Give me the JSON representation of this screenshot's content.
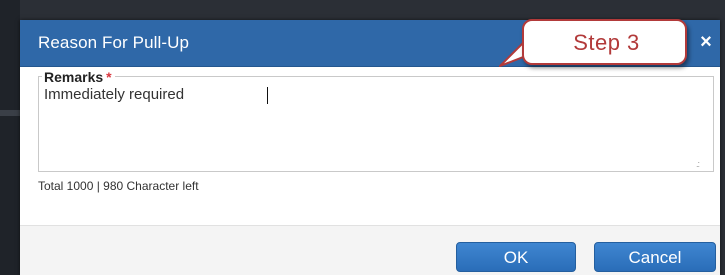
{
  "dialog": {
    "title": "Reason For Pull-Up",
    "close_icon": "×"
  },
  "remarks": {
    "label": "Remarks",
    "required_marker": "*",
    "value": "Immediately required",
    "char_count": "Total 1000 | 980 Character left"
  },
  "footer": {
    "ok_label": "OK",
    "cancel_label": "Cancel"
  },
  "annotation": {
    "callout_text": "Step 3"
  },
  "colors": {
    "header_blue": "#2f68a8",
    "button_blue": "#3479c4",
    "callout_red": "#b23a3a",
    "required_red": "#d9363e"
  }
}
